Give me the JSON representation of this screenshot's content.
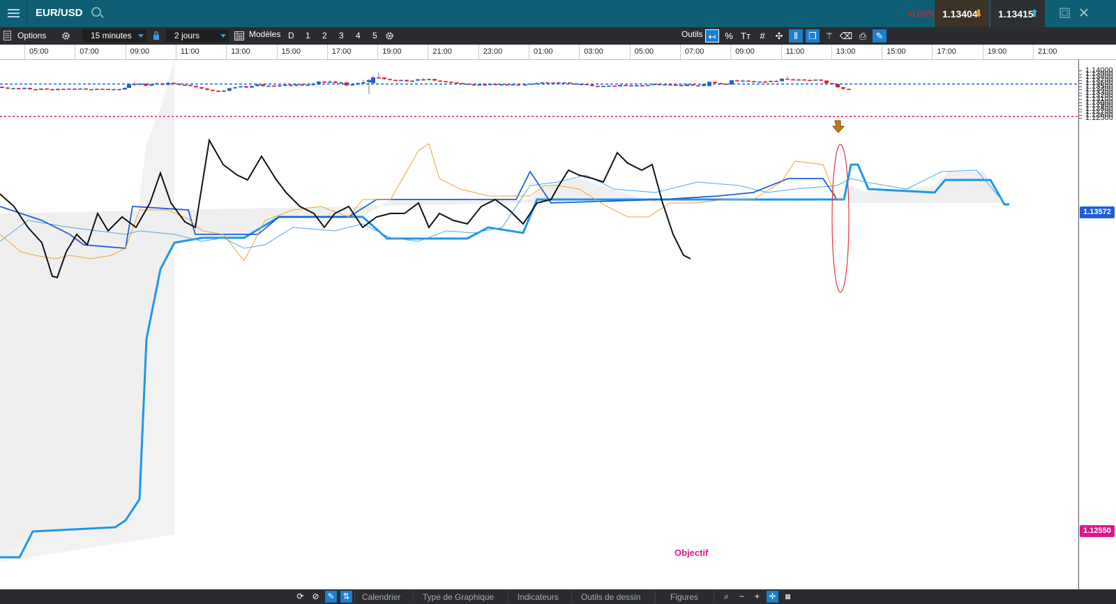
{
  "header": {
    "title": "EUR/USD",
    "change": "-0.06%",
    "bid": "1.13404",
    "ask": "1.13415",
    "bid_arrow": "down",
    "ask_arrow": "up"
  },
  "toolbar": {
    "options_label": "Options",
    "interval": "15 minutes",
    "period": "2 jours",
    "models_label": "Modèles",
    "presets": [
      "D",
      "1",
      "2",
      "3",
      "4",
      "5"
    ],
    "tools_label": "Outils",
    "tool_icons": [
      "arrow-left-icon",
      "percent-icon",
      "text-size-icon",
      "grid-icon",
      "crosshair-icon",
      "candles-icon",
      "layers-icon",
      "indicator-icon",
      "tag-icon",
      "print-icon",
      "settings-draw-icon"
    ]
  },
  "time_axis": [
    "05:00",
    "07:00",
    "09:00",
    "11:00",
    "13:00",
    "15:00",
    "17:00",
    "19:00",
    "21:00",
    "23:00",
    "01:00",
    "03:00",
    "05:00",
    "07:00",
    "09:00",
    "11:00",
    "13:00",
    "15:00",
    "17:00",
    "19:00",
    "21:00"
  ],
  "price_axis": [
    "1.14000",
    "1.13900",
    "1.13800",
    "1.13700",
    "1.13600",
    "1.13500",
    "1.13400",
    "1.13300",
    "1.13200",
    "1.13100",
    "1.13000",
    "1.12900",
    "1.12800",
    "1.12700",
    "1.12600",
    "1.12500"
  ],
  "current_price_tag": "1.13572",
  "target_price_tag": "1.12550",
  "target_label": "Objectif",
  "colors": {
    "bull": "#1f5fd6",
    "bear": "#d91e1e",
    "current_line": "#1f5fd6",
    "target_line": "#e0168a",
    "kijun": "#1e96e8",
    "tenkan": "#f0a030",
    "chikou": "#111111",
    "cloud": "#e8e8e8"
  },
  "bottombar": {
    "items": [
      "Calendrier",
      "Type de Graphique",
      "Indicateurs",
      "Outils de dessin",
      "Figures"
    ]
  }
}
